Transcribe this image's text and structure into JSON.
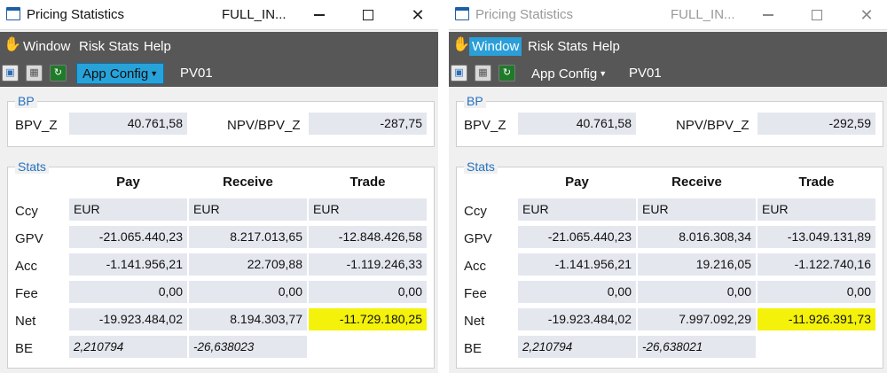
{
  "colors": {
    "menubar": "#575757",
    "accent": "#27a3da",
    "group_title": "#2671c0",
    "highlight": "#f4f20a",
    "field_bg": "#e4e7ee"
  },
  "windows": [
    {
      "title": "Pricing Statistics",
      "title_sub": "FULL_IN...",
      "menu": [
        "Window",
        "Risk Stats",
        "Help"
      ],
      "toolbar": {
        "app_config": "App Config",
        "pv01": "PV01"
      },
      "bp": {
        "title": "BP",
        "bpv_label": "BPV_Z",
        "bpv_value": "40.761,58",
        "npv_label": "NPV/BPV_Z",
        "npv_value": "-287,75"
      },
      "stats": {
        "title": "Stats",
        "columns": [
          "Pay",
          "Receive",
          "Trade"
        ],
        "rows": [
          {
            "label": "Ccy",
            "values": [
              "EUR",
              "EUR",
              "EUR"
            ]
          },
          {
            "label": "GPV",
            "values": [
              "-21.065.440,23",
              "8.217.013,65",
              "-12.848.426,58"
            ]
          },
          {
            "label": "Acc",
            "values": [
              "-1.141.956,21",
              "22.709,88",
              "-1.119.246,33"
            ]
          },
          {
            "label": "Fee",
            "values": [
              "0,00",
              "0,00",
              "0,00"
            ]
          },
          {
            "label": "Net",
            "values": [
              "-19.923.484,02",
              "8.194.303,77",
              "-11.729.180,25"
            ]
          },
          {
            "label": "BE",
            "values": [
              "2,210794",
              "-26,638023"
            ]
          }
        ]
      }
    },
    {
      "title": "Pricing Statistics",
      "title_sub": "FULL_IN...",
      "menu": [
        "Window",
        "Risk Stats",
        "Help"
      ],
      "toolbar": {
        "app_config": "App Config",
        "pv01": "PV01"
      },
      "bp": {
        "title": "BP",
        "bpv_label": "BPV_Z",
        "bpv_value": "40.761,58",
        "npv_label": "NPV/BPV_Z",
        "npv_value": "-292,59"
      },
      "stats": {
        "title": "Stats",
        "columns": [
          "Pay",
          "Receive",
          "Trade"
        ],
        "rows": [
          {
            "label": "Ccy",
            "values": [
              "EUR",
              "EUR",
              "EUR"
            ]
          },
          {
            "label": "GPV",
            "values": [
              "-21.065.440,23",
              "8.016.308,34",
              "-13.049.131,89"
            ]
          },
          {
            "label": "Acc",
            "values": [
              "-1.141.956,21",
              "19.216,05",
              "-1.122.740,16"
            ]
          },
          {
            "label": "Fee",
            "values": [
              "0,00",
              "0,00",
              "0,00"
            ]
          },
          {
            "label": "Net",
            "values": [
              "-19.923.484,02",
              "7.997.092,29",
              "-11.926.391,73"
            ]
          },
          {
            "label": "BE",
            "values": [
              "2,210794",
              "-26,638021"
            ]
          }
        ]
      }
    }
  ]
}
